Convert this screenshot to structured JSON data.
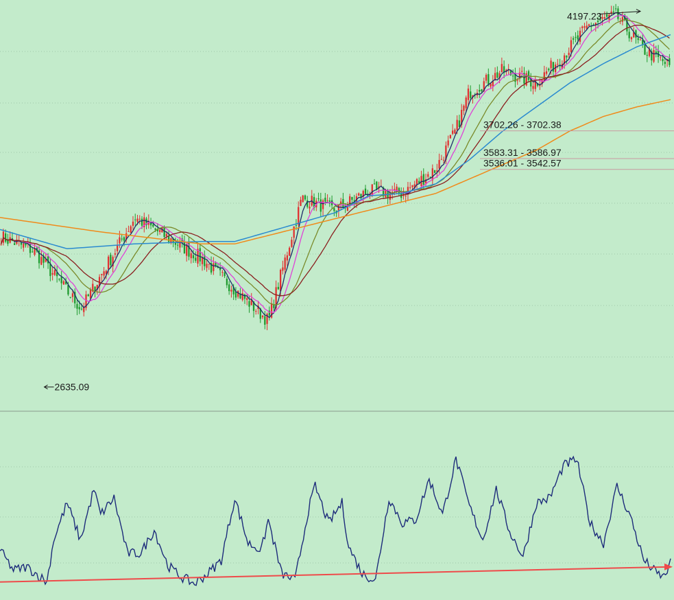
{
  "chart_data": {
    "type": "line",
    "colors": {
      "background": "#c3ebcb",
      "grid": "#9fc7a8",
      "candle_up": "#e03030",
      "candle_down": "#1f9a2e",
      "ma5": "#1c2a6b",
      "ma10": "#e040d8",
      "ma20": "#7a8a2a",
      "ma30": "#8a1e1e",
      "ma60": "#2a8ad0",
      "ma120": "#f08a1a",
      "oscillator": "#1c2a7a",
      "trendline": "#ef4a4a"
    },
    "price_panel": {
      "ylim": [
        2560,
        4230
      ],
      "series": [
        {
          "key": "close",
          "x": [
            0,
            0.05,
            0.12,
            0.2,
            0.3,
            0.4,
            0.45,
            0.5,
            0.55,
            0.6,
            0.65,
            0.68,
            0.7,
            0.75,
            0.8,
            0.84,
            0.88,
            0.92,
            0.96,
            1.0
          ],
          "values": [
            3260,
            3200,
            2960,
            3340,
            3170,
            2910,
            3420,
            3370,
            3450,
            3440,
            3540,
            3700,
            3860,
            3950,
            3900,
            4010,
            4140,
            4180,
            4040,
            3970
          ]
        },
        {
          "key": "ma120",
          "x": [
            0,
            0.15,
            0.3,
            0.35,
            0.45,
            0.55,
            0.65,
            0.7,
            0.75,
            0.8,
            0.85,
            0.9,
            0.95,
            1.0
          ],
          "values": [
            3340,
            3280,
            3230,
            3230,
            3300,
            3370,
            3440,
            3500,
            3560,
            3620,
            3700,
            3760,
            3800,
            3830
          ]
        },
        {
          "key": "ma60",
          "x": [
            0,
            0.1,
            0.2,
            0.3,
            0.35,
            0.4,
            0.5,
            0.55,
            0.6,
            0.65,
            0.7,
            0.75,
            0.8,
            0.85,
            0.9,
            0.95,
            1.0
          ],
          "values": [
            3290,
            3210,
            3230,
            3240,
            3240,
            3280,
            3360,
            3430,
            3440,
            3480,
            3580,
            3700,
            3800,
            3900,
            3980,
            4050,
            4100
          ]
        }
      ],
      "price_lines": [
        {
          "label": "3702.26 - 3702.38",
          "value": 3700
        },
        {
          "label": "3583.31 - 3586.97",
          "value": 3585
        },
        {
          "label": "3536.01 - 3542.57",
          "value": 3540
        }
      ],
      "annotations": [
        {
          "label": "4197.23",
          "x": 0.955,
          "value": 4197.23,
          "side": "left"
        },
        {
          "label": "2635.09",
          "x": 0.066,
          "value": 2635.09,
          "side": "right"
        }
      ]
    },
    "oscillator_panel": {
      "ylim": [
        0,
        100
      ],
      "x": [
        0,
        0.02,
        0.04,
        0.06,
        0.07,
        0.08,
        0.1,
        0.12,
        0.14,
        0.15,
        0.17,
        0.19,
        0.21,
        0.23,
        0.25,
        0.27,
        0.29,
        0.31,
        0.33,
        0.35,
        0.37,
        0.39,
        0.4,
        0.42,
        0.44,
        0.46,
        0.47,
        0.49,
        0.51,
        0.52,
        0.54,
        0.56,
        0.58,
        0.6,
        0.62,
        0.64,
        0.66,
        0.68,
        0.7,
        0.72,
        0.74,
        0.76,
        0.78,
        0.8,
        0.82,
        0.84,
        0.86,
        0.88,
        0.9,
        0.92,
        0.94,
        0.96,
        0.97,
        0.98,
        0.99,
        1.0
      ],
      "values": [
        24,
        12,
        14,
        8,
        5,
        30,
        52,
        30,
        60,
        45,
        55,
        22,
        22,
        36,
        15,
        8,
        4,
        10,
        18,
        55,
        28,
        24,
        42,
        10,
        6,
        48,
        62,
        40,
        52,
        26,
        10,
        6,
        55,
        40,
        42,
        66,
        45,
        78,
        50,
        30,
        60,
        35,
        20,
        52,
        55,
        74,
        78,
        40,
        28,
        62,
        44,
        18,
        14,
        10,
        8,
        16
      ],
      "trendline": {
        "start": 5,
        "end": 14
      }
    }
  }
}
